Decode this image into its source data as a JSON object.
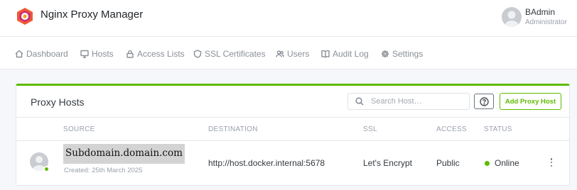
{
  "app": {
    "title": "Nginx Proxy Manager"
  },
  "user": {
    "name": "BAdmin",
    "role": "Administrator"
  },
  "nav": [
    {
      "label": "Dashboard",
      "icon": "home-icon"
    },
    {
      "label": "Hosts",
      "icon": "monitor-icon"
    },
    {
      "label": "Access Lists",
      "icon": "lock-icon"
    },
    {
      "label": "SSL Certificates",
      "icon": "shield-icon"
    },
    {
      "label": "Users",
      "icon": "users-icon"
    },
    {
      "label": "Audit Log",
      "icon": "book-icon"
    },
    {
      "label": "Settings",
      "icon": "gear-icon"
    }
  ],
  "card": {
    "title": "Proxy Hosts",
    "search_placeholder": "Search Host…",
    "add_button": "Add Proxy Host",
    "accent_color": "#5eba00"
  },
  "table": {
    "columns": [
      "SOURCE",
      "DESTINATION",
      "SSL",
      "ACCESS",
      "STATUS"
    ],
    "rows": [
      {
        "source": "Subdomain.domain.com",
        "created": "Created: 25th March 2025",
        "destination": "http://host.docker.internal:5678",
        "ssl": "Let's Encrypt",
        "access": "Public",
        "status": "Online"
      }
    ]
  }
}
